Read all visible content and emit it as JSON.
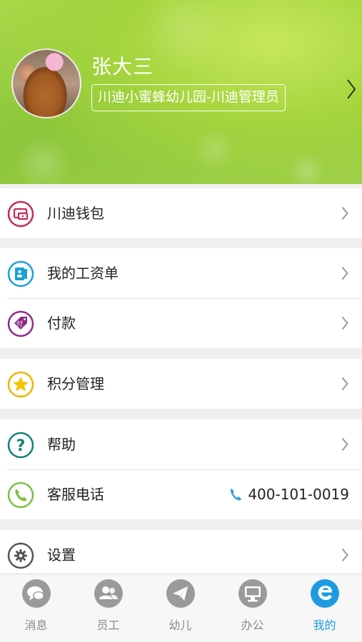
{
  "profile": {
    "name": "张大三",
    "organization": "川迪小蜜蜂幼儿园-川迪管理员"
  },
  "menu": {
    "wallet": {
      "label": "川迪钱包",
      "icon": "wallet-icon",
      "color": "#c8275a"
    },
    "payslip": {
      "label": "我的工资单",
      "icon": "payslip-icon",
      "color": "#1ba0d8"
    },
    "payment": {
      "label": "付款",
      "icon": "pay-tag-icon",
      "badge": "付",
      "color": "#8e2a8a"
    },
    "points": {
      "label": "积分管理",
      "icon": "star-icon",
      "color": "#f0b400"
    },
    "help": {
      "label": "帮助",
      "icon": "question-icon",
      "glyph": "?",
      "color": "#13807a"
    },
    "service": {
      "label": "客服电话",
      "icon": "phone-icon",
      "phone": "400-101-0019",
      "color": "#7bc043",
      "phone_color": "#3aa0e0"
    },
    "settings": {
      "label": "设置",
      "icon": "gear-icon",
      "color": "#555555"
    }
  },
  "tabs": [
    {
      "label": "消息",
      "icon": "chat-icon",
      "active": false
    },
    {
      "label": "员工",
      "icon": "staff-icon",
      "active": false
    },
    {
      "label": "幼儿",
      "icon": "paper-plane-icon",
      "active": false
    },
    {
      "label": "办公",
      "icon": "monitor-icon",
      "active": false
    },
    {
      "label": "我的",
      "icon": "me-icon",
      "active": true
    }
  ],
  "colors": {
    "accent": "#1e9be0",
    "inactive": "#8a8a8a",
    "header_green": "#8cc63a"
  }
}
